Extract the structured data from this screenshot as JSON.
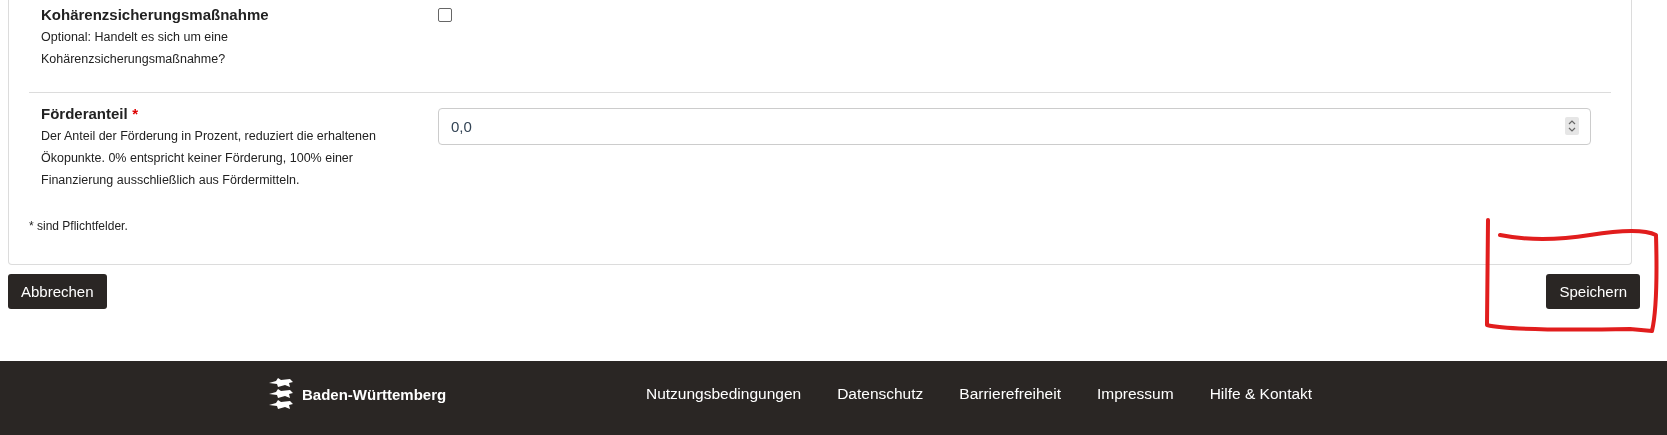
{
  "form": {
    "fields": [
      {
        "kind": "checkbox",
        "label": "Kohärenzsicherungsmaßnahme",
        "help": "Optional: Handelt es sich um eine Kohärenzsicherungsmaßnahme?",
        "checked": false
      },
      {
        "kind": "number",
        "label": "Förderanteil",
        "required_mark": "*",
        "help": "Der Anteil der Förderung in Prozent, reduziert die erhaltenen Ökopunkte. 0% entspricht keiner Förderung, 100% einer Finanzierung ausschließlich aus Fördermitteln.",
        "value": "0,0"
      }
    ],
    "note": "* sind Pflichtfelder."
  },
  "buttons": [
    {
      "label": "Abbrechen"
    },
    {
      "label": "Speichern"
    }
  ],
  "footer": {
    "brand": "Baden-Württemberg",
    "links": [
      "Nutzungsbedingungen",
      "Datenschutz",
      "Barrierefreiheit",
      "Impressum",
      "Hilfe & Kontakt"
    ]
  }
}
